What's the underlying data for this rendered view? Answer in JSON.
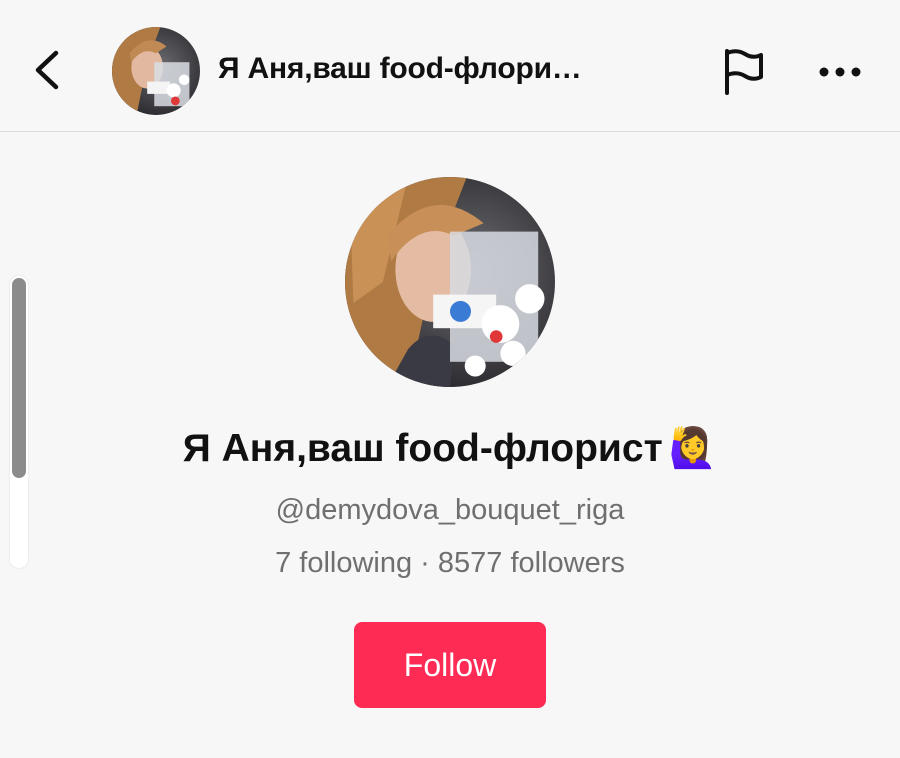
{
  "header": {
    "title": "Я Аня,ваш food-флори…",
    "back_icon": "chevron-left-icon",
    "flag_icon": "flag-icon",
    "more_icon": "more-horizontal-icon"
  },
  "profile": {
    "display_name": "Я Аня,ваш food-флорист",
    "emoji": "🙋‍♀️",
    "username": "@demydova_bouquet_riga",
    "stats": "7 following · 8577 followers"
  },
  "actions": {
    "follow_label": "Follow"
  },
  "colors": {
    "accent": "#fe2c55",
    "background": "#f7f7f7",
    "secondary_text": "#6f6f6f"
  }
}
